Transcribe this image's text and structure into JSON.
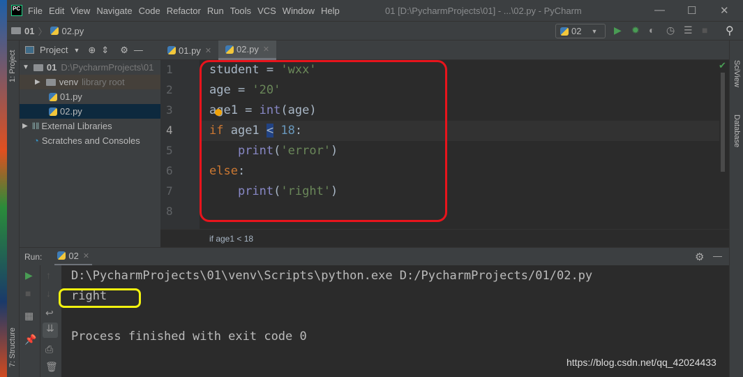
{
  "window": {
    "title": "01 [D:\\PycharmProjects\\01] - ...\\02.py - PyCharm",
    "logo": "PC",
    "minimize": "—",
    "maximize": "☐",
    "close": "✕"
  },
  "menu": [
    "File",
    "Edit",
    "View",
    "Navigate",
    "Code",
    "Refactor",
    "Run",
    "Tools",
    "VCS",
    "Window",
    "Help"
  ],
  "navbar": {
    "project": "01",
    "file": "02.py",
    "run_config": "02"
  },
  "left_strip": {
    "project_label": "1: Project",
    "structure_label": "7: Structure"
  },
  "right_strip": {
    "sciview": "SciView",
    "database": "Database"
  },
  "project_panel": {
    "title": "Project",
    "tree": [
      {
        "label": "01",
        "hint": "D:\\PycharmProjects\\01"
      },
      {
        "label": "venv",
        "hint": "library root"
      },
      {
        "label": "01.py"
      },
      {
        "label": "02.py"
      },
      {
        "label": "External Libraries"
      },
      {
        "label": "Scratches and Consoles"
      }
    ]
  },
  "tabs": [
    {
      "label": "01.py"
    },
    {
      "label": "02.py",
      "active": true
    }
  ],
  "editor": {
    "line_numbers": [
      "1",
      "2",
      "3",
      "4",
      "5",
      "6",
      "7",
      "8"
    ],
    "current_line": 4,
    "lines": [
      [
        [
          "student = ",
          ""
        ],
        [
          "'wxx'",
          "str"
        ]
      ],
      [
        [
          "age = ",
          ""
        ],
        [
          "'20'",
          "str"
        ]
      ],
      [
        [
          "age1 = ",
          ""
        ],
        [
          "int",
          "bi"
        ],
        [
          "(age)",
          ""
        ]
      ],
      [
        [
          "if",
          "kw"
        ],
        [
          " age1 ",
          ""
        ],
        [
          "<",
          "sel"
        ],
        [
          " ",
          ""
        ],
        [
          "18",
          "num"
        ],
        [
          ":",
          ""
        ]
      ],
      [
        [
          "    ",
          ""
        ],
        [
          "print",
          "bi"
        ],
        [
          "(",
          ""
        ],
        [
          "'error'",
          "str"
        ],
        [
          ")",
          ""
        ]
      ],
      [
        [
          "else",
          "kw"
        ],
        [
          ":",
          ""
        ]
      ],
      [
        [
          "    ",
          ""
        ],
        [
          "print",
          "bi"
        ],
        [
          "(",
          ""
        ],
        [
          "'right'",
          "str"
        ],
        [
          ")",
          ""
        ]
      ],
      []
    ]
  },
  "breadcrumb": "if age1 < 18",
  "run": {
    "label": "Run:",
    "tab": "02",
    "console": [
      "D:\\PycharmProjects\\01\\venv\\Scripts\\python.exe D:/PycharmProjects/01/02.py",
      "right",
      "",
      "Process finished with exit code 0"
    ]
  },
  "watermark": "https://blog.csdn.net/qq_42024433",
  "colors": {
    "annotation_red": "#e8141c",
    "annotation_yellow": "#f2f20f",
    "run_green": "#499c54"
  }
}
